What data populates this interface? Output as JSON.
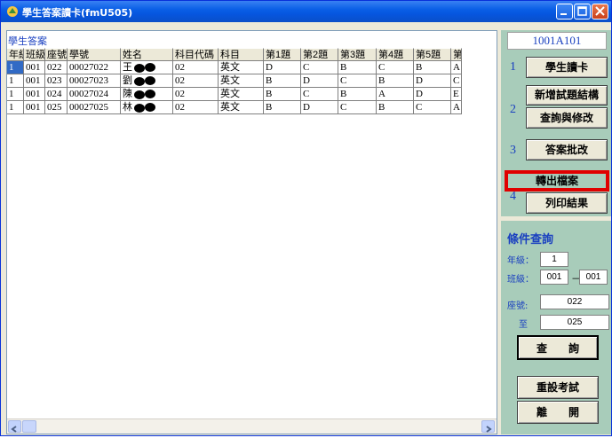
{
  "window": {
    "title": "學生答案讀卡(fmU505)",
    "icon": "app-icon"
  },
  "grid": {
    "caption": "學生答案",
    "columns": [
      "年級",
      "班級",
      "座號",
      "學號",
      "姓名",
      "科目代碼",
      "科目",
      "第1題",
      "第2題",
      "第3題",
      "第4題",
      "第5題",
      "第"
    ],
    "rows": [
      {
        "cells": [
          "1",
          "001",
          "022",
          "00027022",
          "王",
          "02",
          "英文",
          "D",
          "C",
          "B",
          "C",
          "B",
          "A"
        ]
      },
      {
        "cells": [
          "1",
          "001",
          "023",
          "00027023",
          "劉",
          "02",
          "英文",
          "B",
          "D",
          "C",
          "B",
          "D",
          "C"
        ]
      },
      {
        "cells": [
          "1",
          "001",
          "024",
          "00027024",
          "陳",
          "02",
          "英文",
          "B",
          "C",
          "B",
          "A",
          "D",
          "E"
        ]
      },
      {
        "cells": [
          "1",
          "001",
          "025",
          "00027025",
          "林",
          "02",
          "英文",
          "B",
          "D",
          "C",
          "B",
          "C",
          "A"
        ]
      }
    ]
  },
  "panel": {
    "exam_id": "1001A101",
    "steps": [
      "1",
      "2",
      "3",
      "4"
    ],
    "buttons": {
      "read_card": "學生讀卡",
      "add_structure": "新增試題結構",
      "query_edit": "查詢與修改",
      "grade": "答案批改",
      "export": "轉出檔案",
      "print": "列印結果",
      "query": "查　　詢",
      "reset": "重設考試",
      "exit": "離　　開"
    },
    "query": {
      "title": "條件查詢",
      "grade_label": "年級：",
      "grade_value": "1",
      "class_label": "班級：",
      "class_from": "001",
      "class_dash": "－",
      "class_to": "001",
      "seat_label": "座號:",
      "seat_from": "022",
      "to_label": "至",
      "seat_to": "025"
    }
  },
  "colors": {
    "panel_green": "#a8ccba",
    "highlight_red": "#e00000",
    "title_blue": "#0a5fe6"
  }
}
